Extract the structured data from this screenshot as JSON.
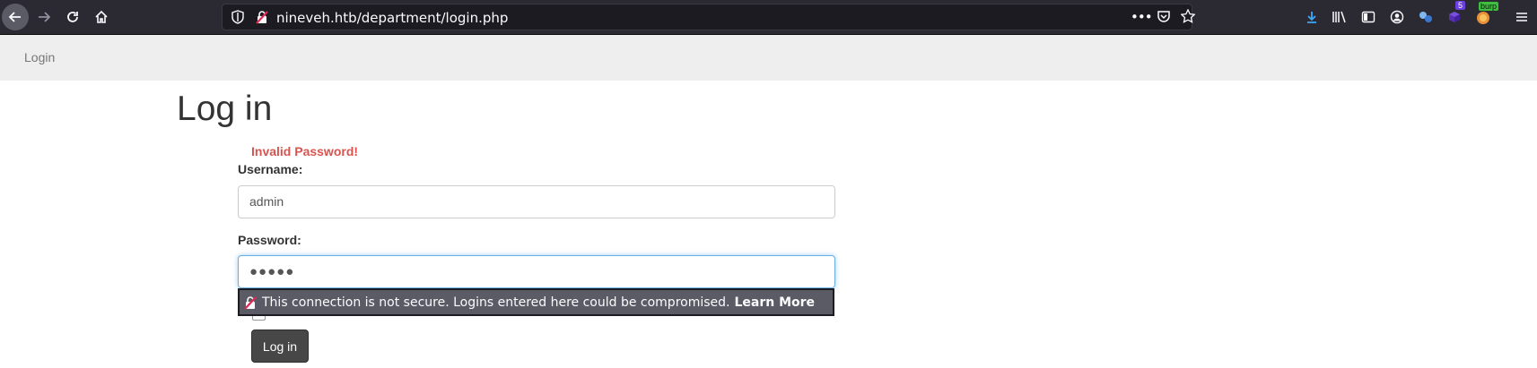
{
  "browser": {
    "url": "nineveh.htb/department/login.php",
    "page_actions_icon": "•••",
    "extensions_badge": "5",
    "burp_label": "burp"
  },
  "navbar": {
    "login_link": "Login"
  },
  "form": {
    "heading": "Log in",
    "error": "Invalid Password!",
    "username_label": "Username:",
    "username_value": "admin",
    "password_label": "Password:",
    "password_value": "●●●●●",
    "submit_label": "Log in"
  },
  "insecure_warning": {
    "message": "This connection is not secure. Logins entered here could be compromised.",
    "learn_more": "Learn More"
  },
  "colors": {
    "toolbar_bg": "#2b2a33",
    "error": "#d9534f",
    "button_bg": "#474747",
    "focus_border": "#66afe9"
  }
}
